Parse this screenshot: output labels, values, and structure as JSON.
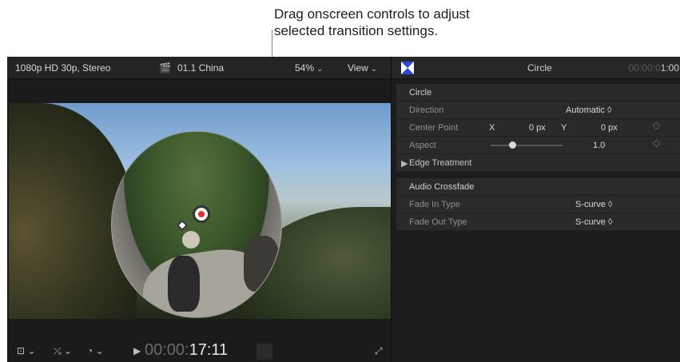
{
  "callout": {
    "line1": "Drag onscreen controls to adjust",
    "line2": "selected transition settings."
  },
  "viewer": {
    "format": "1080p HD 30p, Stereo",
    "clip_name": "01.1 China",
    "clip_icon": "clapperboard-icon",
    "zoom": "54%",
    "view_label": "View",
    "timecode_dim": "00:00:",
    "timecode_bright": "17:11",
    "footer_icons": [
      "layout-dropdown-icon",
      "transform-tools-icon",
      "speed-gauge-icon",
      "play-icon",
      "fullscreen-icon"
    ]
  },
  "inspector": {
    "title": "Circle",
    "timecode_dim": "00:00:0",
    "timecode_bright": "1:00",
    "circle_header": "Circle",
    "direction_label": "Direction",
    "direction_value": "Automatic ◊",
    "center_label": "Center Point",
    "center_x_label": "X",
    "center_x_value": "0 px",
    "center_y_label": "Y",
    "center_y_value": "0 px",
    "aspect_label": "Aspect",
    "aspect_value": "1.0",
    "aspect_slider_fraction": 0.3,
    "edge_label": "Edge Treatment",
    "audio_header": "Audio Crossfade",
    "fade_in_label": "Fade In Type",
    "fade_in_value": "S-curve ◊",
    "fade_out_label": "Fade Out Type",
    "fade_out_value": "S-curve ◊"
  }
}
